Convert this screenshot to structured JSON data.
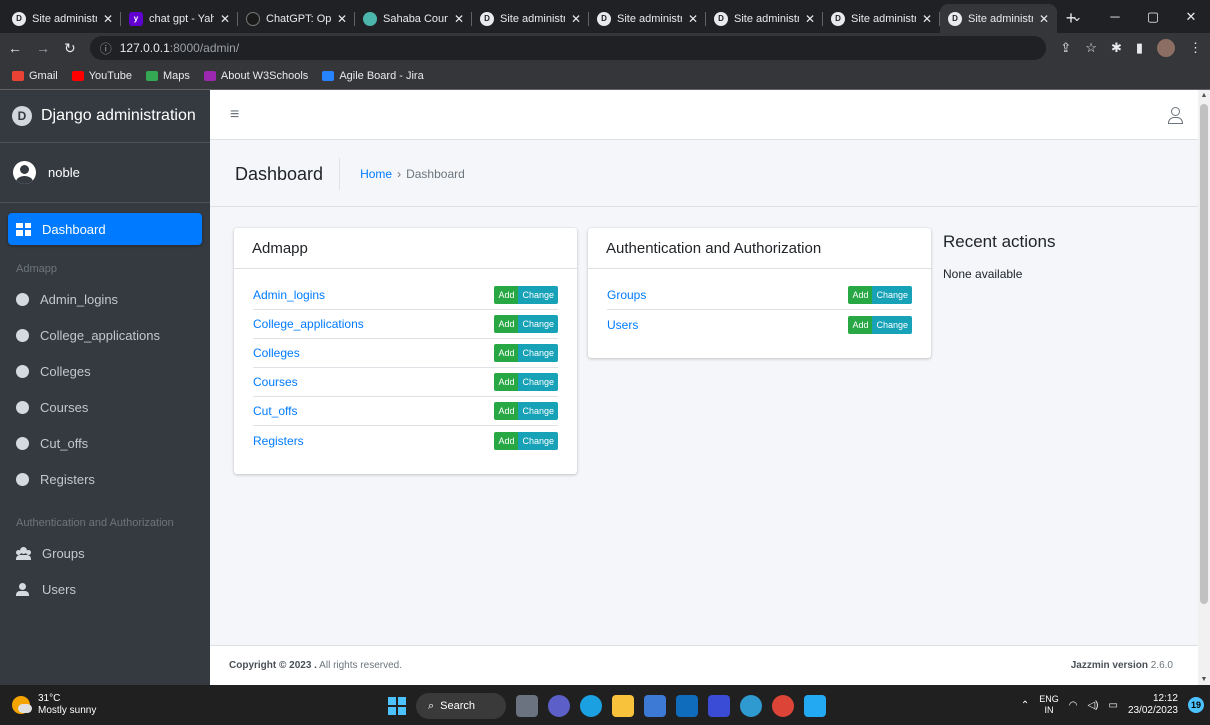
{
  "browser": {
    "tabs": [
      {
        "title": "Site administr",
        "icon": "django-icon",
        "active": false
      },
      {
        "title": "chat gpt - Yah",
        "icon": "yahoo-icon",
        "active": false
      },
      {
        "title": "ChatGPT: Opti",
        "icon": "chatgpt-icon",
        "active": false
      },
      {
        "title": "Sahaba Count",
        "icon": "sahaba-icon",
        "active": false
      },
      {
        "title": "Site administr",
        "icon": "django-icon",
        "active": false
      },
      {
        "title": "Site administr",
        "icon": "django-icon",
        "active": false
      },
      {
        "title": "Site administr",
        "icon": "django-icon",
        "active": false
      },
      {
        "title": "Site administr",
        "icon": "django-icon",
        "active": false
      },
      {
        "title": "Site administr",
        "icon": "django-icon",
        "active": true
      }
    ],
    "address": {
      "host": "127.0.0.1",
      "path": ":8000/admin/"
    },
    "bookmarks": [
      {
        "label": "Gmail",
        "color": "#ea4335"
      },
      {
        "label": "YouTube",
        "color": "#ff0000"
      },
      {
        "label": "Maps",
        "color": "#34a853"
      },
      {
        "label": "About W3Schools",
        "color": "#9c27b0"
      },
      {
        "label": "Agile Board - Jira",
        "color": "#2684ff"
      }
    ]
  },
  "sidebar": {
    "brand": "Django administration",
    "user": "noble",
    "dashboard_label": "Dashboard",
    "section1": "Admapp",
    "section1_items": [
      "Admin_logins",
      "College_applications",
      "Colleges",
      "Courses",
      "Cut_offs",
      "Registers"
    ],
    "section2": "Authentication and Authorization",
    "groups_label": "Groups",
    "users_label": "Users"
  },
  "header": {
    "title": "Dashboard",
    "breadcrumb_home": "Home",
    "breadcrumb_sep": "›",
    "breadcrumb_current": "Dashboard"
  },
  "cards": {
    "admapp": {
      "title": "Admapp",
      "models": [
        "Admin_logins",
        "College_applications",
        "Colleges",
        "Courses",
        "Cut_offs",
        "Registers"
      ]
    },
    "auth": {
      "title": "Authentication and Authorization",
      "models": [
        "Groups",
        "Users"
      ]
    },
    "add_label": "Add",
    "change_label": "Change"
  },
  "recent": {
    "title": "Recent actions",
    "none": "None available"
  },
  "footer": {
    "copyright_bold": "Copyright © 2023 .",
    "copyright_rest": " All rights reserved.",
    "version_bold": "Jazzmin version",
    "version": " 2.6.0"
  },
  "taskbar": {
    "temp": "31°C",
    "weather": "Mostly sunny",
    "search": "Search",
    "lang1": "ENG",
    "lang2": "IN",
    "time": "12:12",
    "date": "23/02/2023",
    "notifications": "19"
  },
  "colors": {
    "primary": "#007bff",
    "success": "#28a745",
    "info": "#17a2b8",
    "sidebar": "#343a40"
  }
}
